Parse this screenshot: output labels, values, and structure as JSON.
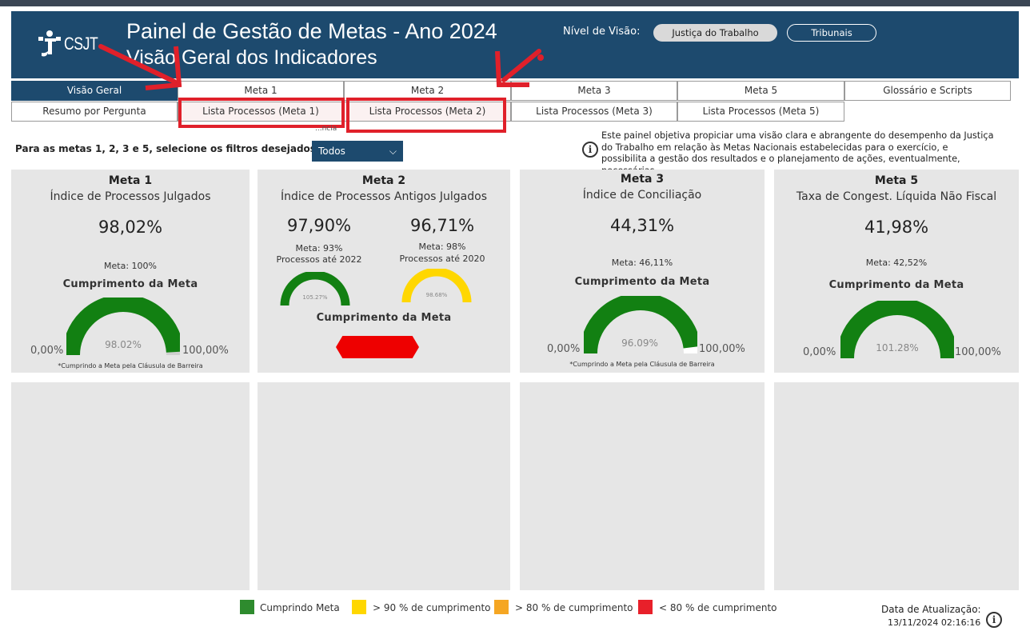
{
  "header": {
    "logo_text": "CSJT",
    "title": "Painel de Gestão de Metas - Ano 2024",
    "subtitle": "Visão Geral dos Indicadores",
    "nivel_label": "Nível de Visão:",
    "nivel_options": [
      "Justiça do Trabalho",
      "Tribunais"
    ]
  },
  "tabs_row1": [
    "Visão Geral",
    "Meta 1",
    "Meta 2",
    "Meta 3",
    "Meta 5",
    "Glossário e Scripts"
  ],
  "tabs_row2": [
    "Resumo por Pergunta",
    "Lista Processos (Meta 1)",
    "Lista Processos (Meta 2)",
    "Lista Processos (Meta 3)",
    "Lista Processos (Meta 5)"
  ],
  "filter": {
    "label": "Para as metas 1, 2, 3 e 5, selecione os filtros desejados:",
    "hint": "...ncia",
    "value": "Todos"
  },
  "description": "Este painel objetiva propiciar uma visão clara e abrangente do desempenho da Justiça do Trabalho em relação às Metas Nacionais estabelecidas para o exercício, e possibilita a gestão dos resultados e o planejamento de ações, eventualmente, necessárias.",
  "cards": {
    "meta1": {
      "title": "Meta 1",
      "subtitle": "Índice de Processos Julgados",
      "value": "98,02%",
      "meta": "Meta: 100%",
      "cumprimento_label": "Cumprimento da Meta",
      "gauge_value": "98.02%",
      "gauge_fraction": 0.9802,
      "range_min": "0,00%",
      "range_max": "100,00%",
      "footnote": "*Cumprindo a Meta pela Cláusula de Barreira"
    },
    "meta2": {
      "title": "Meta 2",
      "subtitle": "Índice de Processos Antigos Julgados",
      "value_a": "97,90%",
      "meta_a": "Meta: 93%",
      "desc_a": "Processos até 2022",
      "gauge_a_value": "105.27%",
      "value_b": "96,71%",
      "meta_b": "Meta: 98%",
      "desc_b": "Processos até 2020",
      "gauge_b_value": "98.68%",
      "cumprimento_label": "Cumprimento da Meta"
    },
    "meta3": {
      "title": "Meta 3",
      "subtitle": "Índice de Conciliação",
      "value": "44,31%",
      "meta": "Meta: 46,11%",
      "cumprimento_label": "Cumprimento da Meta",
      "gauge_value": "96.09%",
      "gauge_fraction": 0.9609,
      "range_min": "0,00%",
      "range_max": "100,00%",
      "footnote": "*Cumprindo a Meta pela Cláusula de Barreira"
    },
    "meta5": {
      "title": "Meta 5",
      "subtitle": "Taxa de Congest. Líquida Não Fiscal",
      "value": "41,98%",
      "meta": "Meta: 42,52%",
      "cumprimento_label": "Cumprimento da Meta",
      "gauge_value": "101.28%",
      "gauge_fraction": 1.0,
      "range_min": "0,00%",
      "range_max": "100,00%"
    }
  },
  "legend": [
    {
      "label": "Cumprindo Meta",
      "color": "#2e8b2e"
    },
    {
      "label": "> 90 % de cumprimento",
      "color": "#ffd700"
    },
    {
      "label": "> 80 % de cumprimento",
      "color": "#f5a623"
    },
    {
      "label": "< 80 % de cumprimento",
      "color": "#e8202a"
    }
  ],
  "update": {
    "label": "Data de Atualização:",
    "date": "13/11/2024 02:16:16"
  },
  "colors": {
    "header_bg": "#1d4a6e",
    "gauge_green": "#128012",
    "gauge_yellow": "#ffd700",
    "alert_red": "#ee0000",
    "annotation_red": "#e0202a"
  }
}
